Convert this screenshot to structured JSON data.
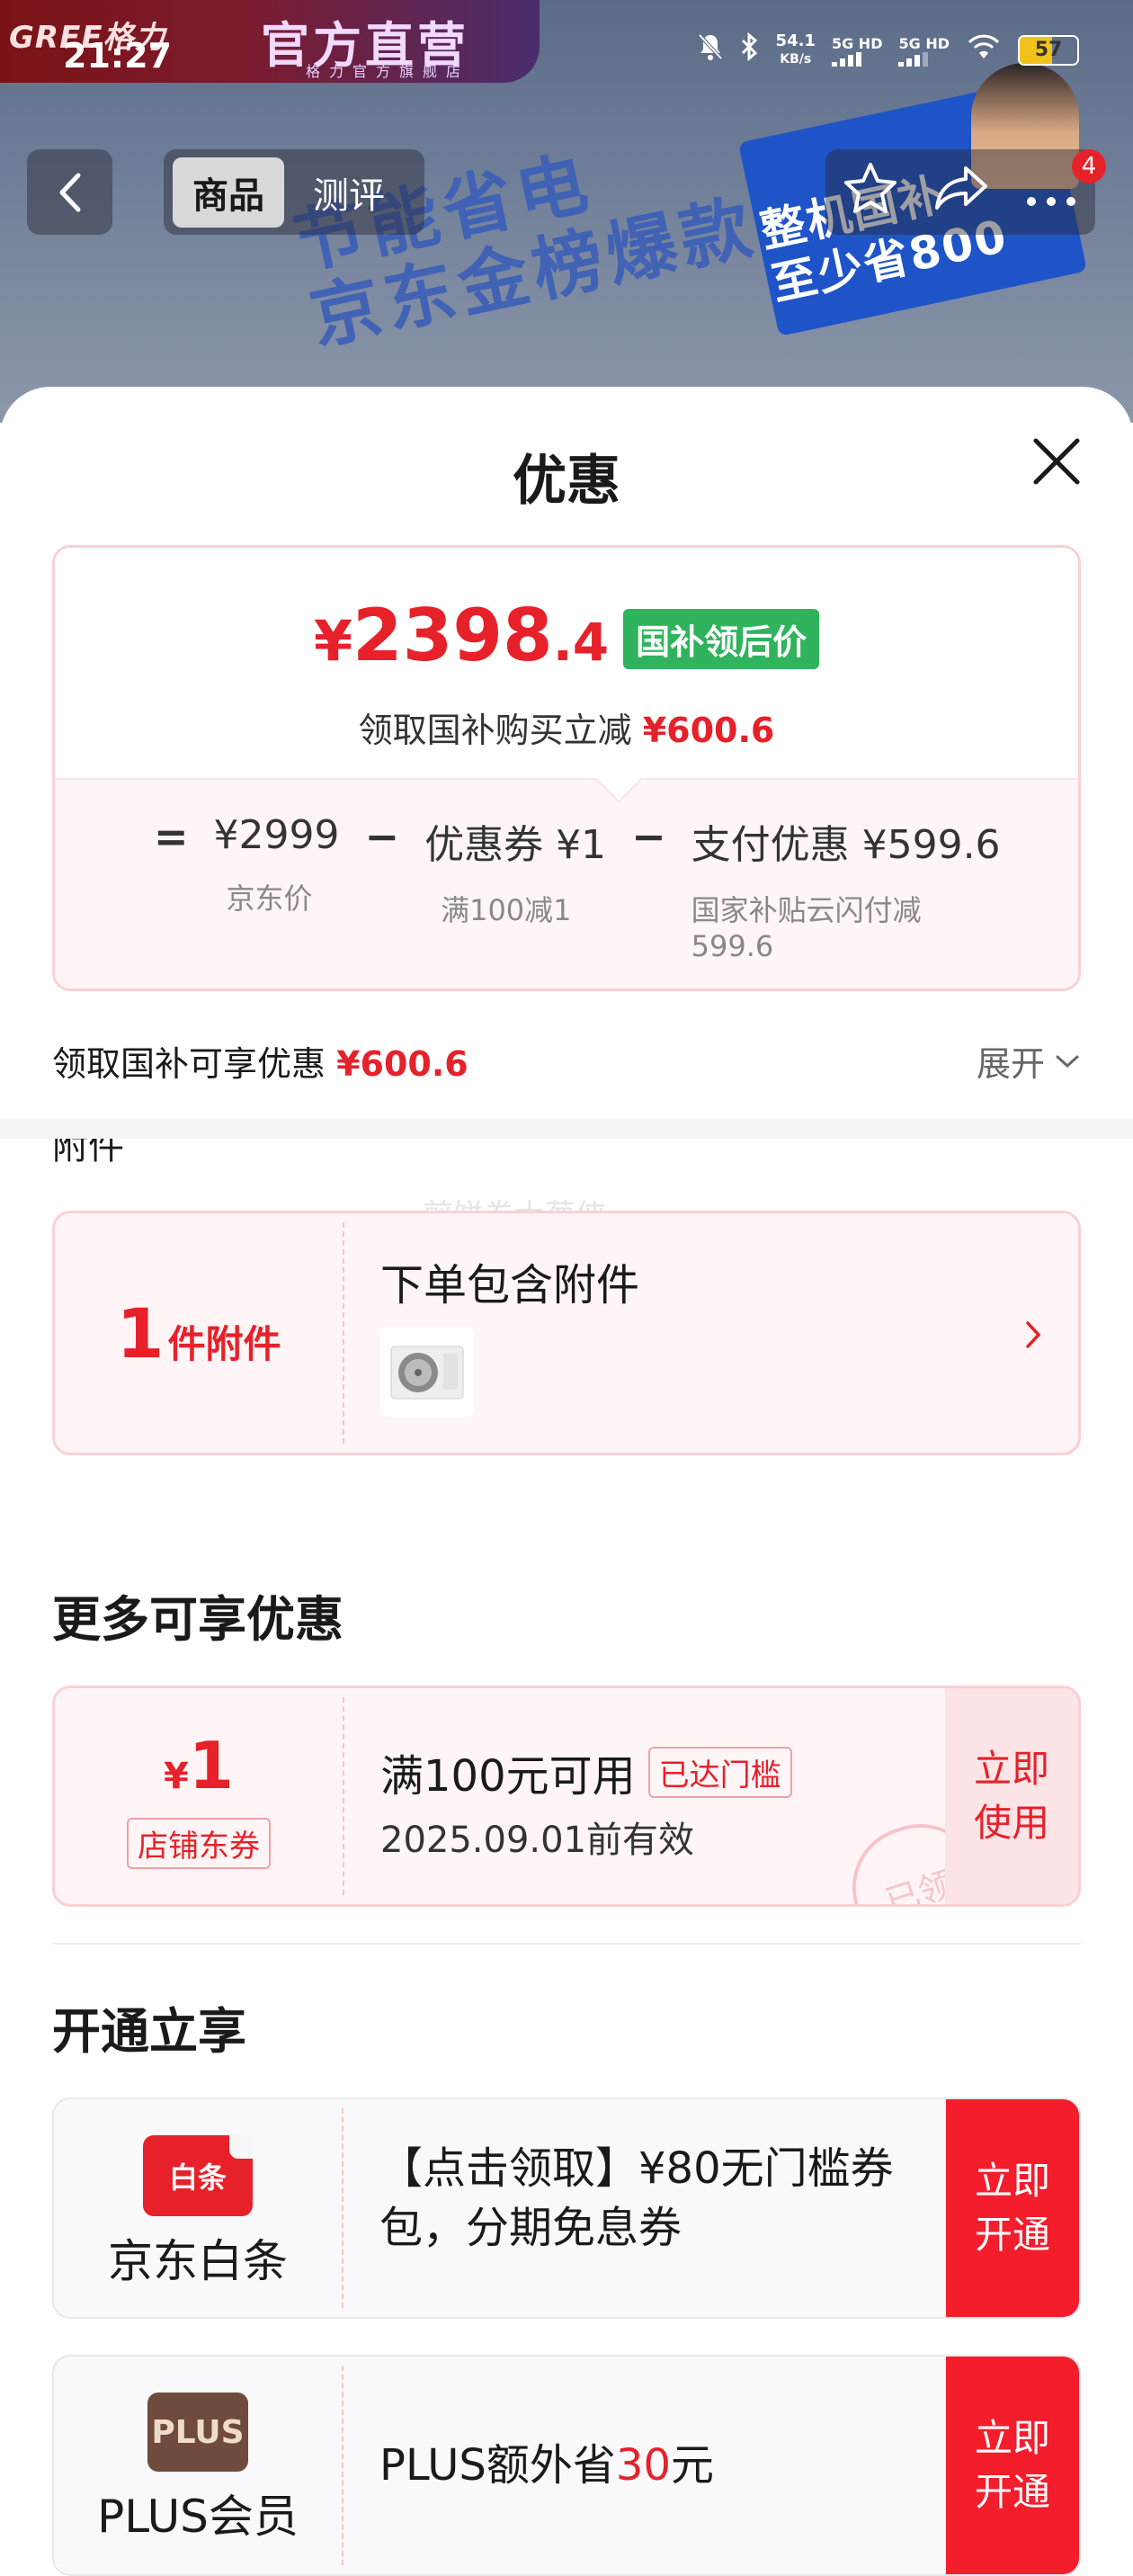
{
  "status_bar": {
    "time": "21:27",
    "net_speed_value": "54.1",
    "net_speed_unit": "KB/s",
    "sim1": "5G HD",
    "sim2": "5G HD",
    "battery": "57",
    "battery_level": 0.57
  },
  "banner": {
    "brand_logo": "GREE格力",
    "brand_flagship": "官方直营",
    "brand_sub": "格力官方旗舰店",
    "slogan_line1": "节能省电",
    "slogan_line2": "京东金榜爆款",
    "promo_line1": "整机国补",
    "promo_line2": "至少省800"
  },
  "nav": {
    "tabs": [
      {
        "label": "商品",
        "active": true
      },
      {
        "label": "测评",
        "active": false
      }
    ],
    "badge_count": "4"
  },
  "sheet": {
    "title": "优惠",
    "price": {
      "currency": "¥",
      "integer": "2398",
      "decimal": ".4",
      "tag": "国补领后价",
      "subtitle_prefix": "领取国补购买立减",
      "subtitle_amount": "¥600.6"
    },
    "formula": {
      "equals": "=",
      "minus": "−",
      "items": [
        {
          "value": "¥2999",
          "label": "京东价"
        },
        {
          "value": "优惠券 ¥1",
          "label": "满100减1"
        },
        {
          "value": "支付优惠 ¥599.6",
          "label_line1": "国家补贴云闪付减",
          "label_line2": "599.6"
        }
      ]
    },
    "discount_line": {
      "prefix": "领取国补可享优惠",
      "amount": "¥600.6"
    },
    "expand_label": "展开",
    "attachments_label": "附件",
    "watermark": "煎饼卷大葱侠",
    "attachment_card": {
      "count": "1",
      "unit": "件附件",
      "title": "下单包含附件"
    },
    "more_section_title": "更多可享优惠",
    "coupon": {
      "currency": "¥",
      "amount": "1",
      "type": "店铺东券",
      "title": "满100元可用",
      "reached": "已达门槛",
      "valid": "2025.09.01前有效",
      "use_line1": "立即",
      "use_line2": "使用",
      "stamp": "已领"
    },
    "open_section_title": "开通立享",
    "open_cards": [
      {
        "icon_text": "白条",
        "name": "京东白条",
        "desc": "【点击领取】¥80无门槛券包，分期免息券",
        "btn_line1": "立即",
        "btn_line2": "开通"
      },
      {
        "icon_text": "PLUS",
        "name": "PLUS会员",
        "desc_prefix": "PLUS额外省",
        "desc_amount": "30",
        "desc_suffix": "元",
        "btn_line1": "立即",
        "btn_line2": "开通"
      }
    ]
  },
  "colors": {
    "accent_red": "#e6212a",
    "tag_green": "#2fb35c",
    "open_button_red": "#f41d2c",
    "plus_brown": "#6e4b3d"
  }
}
